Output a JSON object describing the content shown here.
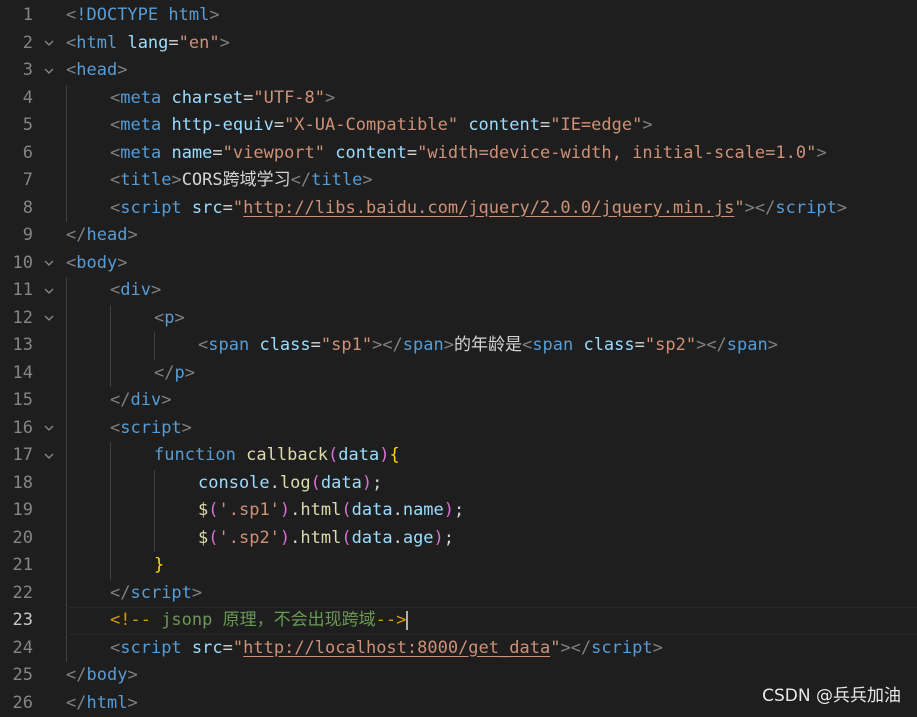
{
  "editor": {
    "lines": [
      {
        "num": "1",
        "fold": false,
        "tokens": [
          [
            "punc",
            "<"
          ],
          [
            "tag",
            "!DOCTYPE"
          ],
          [
            "text",
            " "
          ],
          [
            "tag",
            "html"
          ],
          [
            "punc",
            ">"
          ]
        ]
      },
      {
        "num": "2",
        "fold": true,
        "tokens": [
          [
            "punc",
            "<"
          ],
          [
            "tag",
            "html"
          ],
          [
            "text",
            " "
          ],
          [
            "attr",
            "lang"
          ],
          [
            "eq",
            "="
          ],
          [
            "str",
            "\"en\""
          ],
          [
            "punc",
            ">"
          ]
        ]
      },
      {
        "num": "3",
        "fold": true,
        "tokens": [
          [
            "punc",
            "<"
          ],
          [
            "tag",
            "head"
          ],
          [
            "punc",
            ">"
          ]
        ]
      },
      {
        "num": "4",
        "fold": false,
        "indent": 1,
        "tokens": [
          [
            "punc",
            "<"
          ],
          [
            "tag",
            "meta"
          ],
          [
            "text",
            " "
          ],
          [
            "attr",
            "charset"
          ],
          [
            "eq",
            "="
          ],
          [
            "str",
            "\"UTF-8\""
          ],
          [
            "punc",
            ">"
          ]
        ]
      },
      {
        "num": "5",
        "fold": false,
        "indent": 1,
        "tokens": [
          [
            "punc",
            "<"
          ],
          [
            "tag",
            "meta"
          ],
          [
            "text",
            " "
          ],
          [
            "attr",
            "http-equiv"
          ],
          [
            "eq",
            "="
          ],
          [
            "str",
            "\"X-UA-Compatible\""
          ],
          [
            "text",
            " "
          ],
          [
            "attr",
            "content"
          ],
          [
            "eq",
            "="
          ],
          [
            "str",
            "\"IE=edge\""
          ],
          [
            "punc",
            ">"
          ]
        ]
      },
      {
        "num": "6",
        "fold": false,
        "indent": 1,
        "tokens": [
          [
            "punc",
            "<"
          ],
          [
            "tag",
            "meta"
          ],
          [
            "text",
            " "
          ],
          [
            "attr",
            "name"
          ],
          [
            "eq",
            "="
          ],
          [
            "str",
            "\"viewport\""
          ],
          [
            "text",
            " "
          ],
          [
            "attr",
            "content"
          ],
          [
            "eq",
            "="
          ],
          [
            "str",
            "\"width=device-width, initial-scale=1.0\""
          ],
          [
            "punc",
            ">"
          ]
        ]
      },
      {
        "num": "7",
        "fold": false,
        "indent": 1,
        "tokens": [
          [
            "punc",
            "<"
          ],
          [
            "tag",
            "title"
          ],
          [
            "punc",
            ">"
          ],
          [
            "text",
            "CORS跨域学习"
          ],
          [
            "punc",
            "</"
          ],
          [
            "tag",
            "title"
          ],
          [
            "punc",
            ">"
          ]
        ]
      },
      {
        "num": "8",
        "fold": false,
        "indent": 1,
        "tokens": [
          [
            "punc",
            "<"
          ],
          [
            "tag",
            "script"
          ],
          [
            "text",
            " "
          ],
          [
            "attr",
            "src"
          ],
          [
            "eq",
            "="
          ],
          [
            "str",
            "\""
          ],
          [
            "url",
            "http://libs.baidu.com/jquery/2.0.0/jquery.min.js"
          ],
          [
            "str",
            "\""
          ],
          [
            "punc",
            "></"
          ],
          [
            "tag",
            "script"
          ],
          [
            "punc",
            ">"
          ]
        ]
      },
      {
        "num": "9",
        "fold": false,
        "tokens": [
          [
            "punc",
            "</"
          ],
          [
            "tag",
            "head"
          ],
          [
            "punc",
            ">"
          ]
        ]
      },
      {
        "num": "10",
        "fold": true,
        "tokens": [
          [
            "punc",
            "<"
          ],
          [
            "tag",
            "body"
          ],
          [
            "punc",
            ">"
          ]
        ]
      },
      {
        "num": "11",
        "fold": true,
        "indent": 1,
        "tokens": [
          [
            "punc",
            "<"
          ],
          [
            "tag",
            "div"
          ],
          [
            "punc",
            ">"
          ]
        ]
      },
      {
        "num": "12",
        "fold": true,
        "indent": 2,
        "tokens": [
          [
            "punc",
            "<"
          ],
          [
            "tag",
            "p"
          ],
          [
            "punc",
            ">"
          ]
        ]
      },
      {
        "num": "13",
        "fold": false,
        "indent": 3,
        "tokens": [
          [
            "punc",
            "<"
          ],
          [
            "tag",
            "span"
          ],
          [
            "text",
            " "
          ],
          [
            "attr",
            "class"
          ],
          [
            "eq",
            "="
          ],
          [
            "str",
            "\"sp1\""
          ],
          [
            "punc",
            "></"
          ],
          [
            "tag",
            "span"
          ],
          [
            "punc",
            ">"
          ],
          [
            "text",
            "的年龄是"
          ],
          [
            "punc",
            "<"
          ],
          [
            "tag",
            "span"
          ],
          [
            "text",
            " "
          ],
          [
            "attr",
            "class"
          ],
          [
            "eq",
            "="
          ],
          [
            "str",
            "\"sp2\""
          ],
          [
            "punc",
            "></"
          ],
          [
            "tag",
            "span"
          ],
          [
            "punc",
            ">"
          ]
        ]
      },
      {
        "num": "14",
        "fold": false,
        "indent": 2,
        "tokens": [
          [
            "punc",
            "</"
          ],
          [
            "tag",
            "p"
          ],
          [
            "punc",
            ">"
          ]
        ]
      },
      {
        "num": "15",
        "fold": false,
        "indent": 1,
        "tokens": [
          [
            "punc",
            "</"
          ],
          [
            "tag",
            "div"
          ],
          [
            "punc",
            ">"
          ]
        ]
      },
      {
        "num": "16",
        "fold": true,
        "indent": 1,
        "tokens": [
          [
            "punc",
            "<"
          ],
          [
            "tag",
            "script"
          ],
          [
            "punc",
            ">"
          ]
        ]
      },
      {
        "num": "17",
        "fold": true,
        "indent": 2,
        "tokens": [
          [
            "kw",
            "function"
          ],
          [
            "text",
            " "
          ],
          [
            "fn",
            "callback"
          ],
          [
            "br2",
            "("
          ],
          [
            "var",
            "data"
          ],
          [
            "br2",
            ")"
          ],
          [
            "br1",
            "{"
          ]
        ]
      },
      {
        "num": "18",
        "fold": false,
        "indent": 3,
        "tokens": [
          [
            "var",
            "console"
          ],
          [
            "text",
            "."
          ],
          [
            "fn",
            "log"
          ],
          [
            "br2",
            "("
          ],
          [
            "var",
            "data"
          ],
          [
            "br2",
            ")"
          ],
          [
            "text",
            ";"
          ]
        ]
      },
      {
        "num": "19",
        "fold": false,
        "indent": 3,
        "tokens": [
          [
            "fn",
            "$"
          ],
          [
            "br2",
            "("
          ],
          [
            "str",
            "'.sp1'"
          ],
          [
            "br2",
            ")"
          ],
          [
            "text",
            "."
          ],
          [
            "fn",
            "html"
          ],
          [
            "br2",
            "("
          ],
          [
            "var",
            "data"
          ],
          [
            "text",
            "."
          ],
          [
            "var",
            "name"
          ],
          [
            "br2",
            ")"
          ],
          [
            "text",
            ";"
          ]
        ]
      },
      {
        "num": "20",
        "fold": false,
        "indent": 3,
        "tokens": [
          [
            "fn",
            "$"
          ],
          [
            "br2",
            "("
          ],
          [
            "str",
            "'.sp2'"
          ],
          [
            "br2",
            ")"
          ],
          [
            "text",
            "."
          ],
          [
            "fn",
            "html"
          ],
          [
            "br2",
            "("
          ],
          [
            "var",
            "data"
          ],
          [
            "text",
            "."
          ],
          [
            "var",
            "age"
          ],
          [
            "br2",
            ")"
          ],
          [
            "text",
            ";"
          ]
        ]
      },
      {
        "num": "21",
        "fold": false,
        "indent": 2,
        "tokens": [
          [
            "br1",
            "}"
          ]
        ]
      },
      {
        "num": "22",
        "fold": false,
        "indent": 1,
        "tokens": [
          [
            "punc",
            "</"
          ],
          [
            "tag",
            "script"
          ],
          [
            "punc",
            ">"
          ]
        ]
      },
      {
        "num": "23",
        "fold": false,
        "indent": 1,
        "current": true,
        "tokens": [
          [
            "cmark",
            "<!--"
          ],
          [
            "comment",
            " jsonp 原理，不会出现跨域"
          ],
          [
            "cmark",
            "-->"
          ]
        ]
      },
      {
        "num": "24",
        "fold": false,
        "indent": 1,
        "tokens": [
          [
            "punc",
            "<"
          ],
          [
            "tag",
            "script"
          ],
          [
            "text",
            " "
          ],
          [
            "attr",
            "src"
          ],
          [
            "eq",
            "="
          ],
          [
            "str",
            "\""
          ],
          [
            "url",
            "http://localhost:8000/get_data"
          ],
          [
            "str",
            "\""
          ],
          [
            "punc",
            "></"
          ],
          [
            "tag",
            "script"
          ],
          [
            "punc",
            ">"
          ]
        ]
      },
      {
        "num": "25",
        "fold": false,
        "tokens": [
          [
            "punc",
            "</"
          ],
          [
            "tag",
            "body"
          ],
          [
            "punc",
            ">"
          ]
        ]
      },
      {
        "num": "26",
        "fold": false,
        "tokens": [
          [
            "punc",
            "</"
          ],
          [
            "tag",
            "html"
          ],
          [
            "punc",
            ">"
          ]
        ]
      }
    ]
  },
  "watermark": {
    "text": "CSDN @兵兵加油"
  },
  "colors": {
    "background": "#1e1e1e",
    "tag": "#569cd6",
    "attribute": "#9cdcfe",
    "string": "#ce9178",
    "function": "#dcdcaa",
    "comment": "#6a9955",
    "bracket_gold": "#ffd700",
    "bracket_purple": "#da70d6"
  },
  "icons": {
    "fold_marker": "chevron-down-icon"
  }
}
